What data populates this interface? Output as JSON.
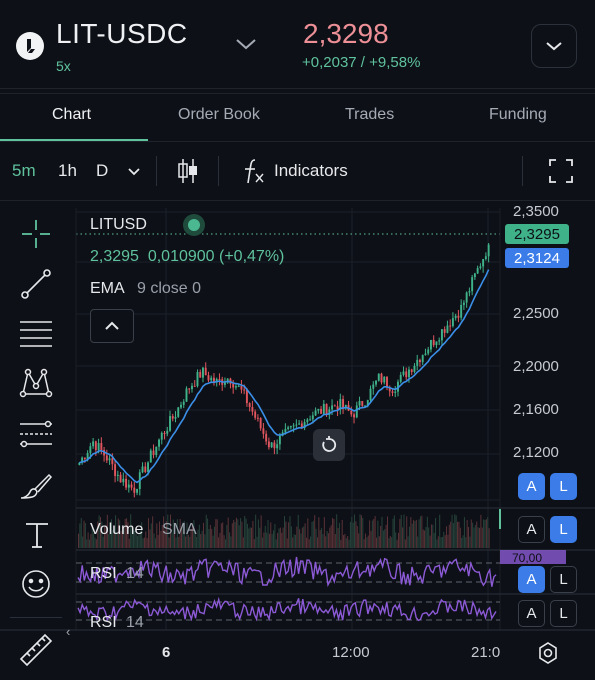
{
  "header": {
    "pair": "LIT-USDC",
    "leverage": "5x",
    "price": "2,3298",
    "change": "+0,2037 / +9,58%"
  },
  "tabs": [
    {
      "label": "Chart",
      "active": true
    },
    {
      "label": "Order Book",
      "active": false
    },
    {
      "label": "Trades",
      "active": false
    },
    {
      "label": "Funding",
      "active": false
    }
  ],
  "toolbar": {
    "intervals": [
      "5m",
      "1h",
      "D"
    ],
    "active_interval": "5m",
    "indicators_label": "Indicators"
  },
  "legend": {
    "symbol": "LITUSD",
    "values": "2,3295  0,010900 (+0,47%)",
    "ema": "EMA",
    "ema_params": "9 close 0"
  },
  "price_axis": [
    "2,3500",
    "2,2500",
    "2,2000",
    "2,1600",
    "2,1200"
  ],
  "price_tags": {
    "last": "2,3295",
    "ema": "2,3124"
  },
  "time_axis": [
    "6",
    "12:00",
    "21:0"
  ],
  "panes": {
    "volume_label": "Volume",
    "volume_param": "SMA",
    "rsi1_label": "RSI",
    "rsi1_param": "14",
    "rsi2_label": "RSI",
    "rsi2_param": "14",
    "rsi_partial_value": "70,00"
  },
  "badges": {
    "a": "A",
    "l": "L"
  },
  "drawing_tools": [
    "crosshair-icon",
    "trendline-icon",
    "fib-lines-icon",
    "pattern-icon",
    "prediction-icon",
    "brush-icon",
    "text-icon",
    "emoji-icon",
    "ruler-icon"
  ],
  "colors": {
    "accent": "#5fc29d",
    "price_red": "#ec8f96",
    "candle_up": "#3fb28a",
    "candle_down": "#e0555e",
    "ema": "#3b8fe8",
    "rsi": "#8c5ad6",
    "badge_blue": "#3b7ce8"
  },
  "chart_data": {
    "type": "candlestick",
    "symbol": "LITUSD",
    "ylim": [
      2.09,
      2.36
    ],
    "x_ticks": [
      "6",
      "12:00",
      "21:0"
    ],
    "trend_close": [
      2.125,
      2.145,
      2.13,
      2.11,
      2.1,
      2.125,
      2.15,
      2.17,
      2.195,
      2.21,
      2.2,
      2.205,
      2.19,
      2.165,
      2.14,
      2.15,
      2.16,
      2.17,
      2.175,
      2.18,
      2.17,
      2.185,
      2.205,
      2.195,
      2.21,
      2.225,
      2.24,
      2.255,
      2.27,
      2.3,
      2.3295
    ],
    "last": 2.3295,
    "ema9": 2.3124
  }
}
